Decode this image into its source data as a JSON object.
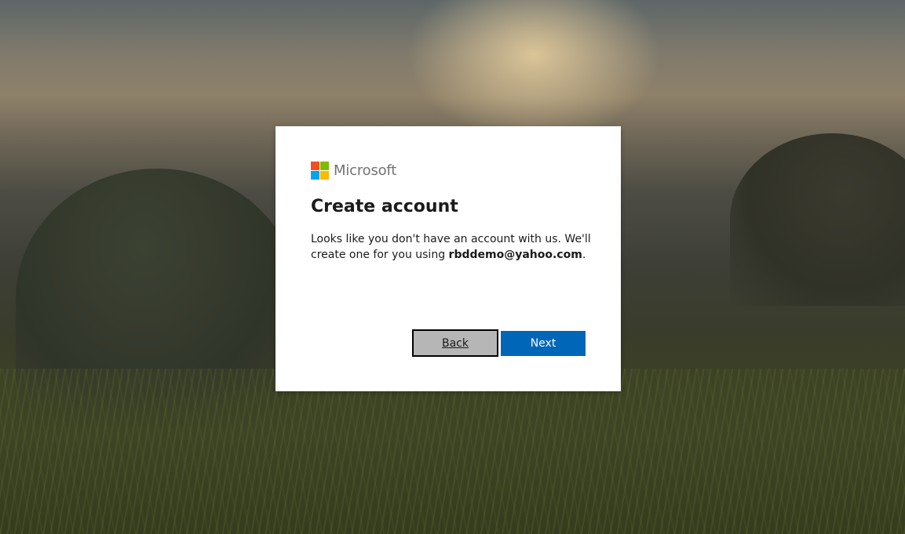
{
  "brand": {
    "name": "Microsoft",
    "logo_colors": [
      "#f25022",
      "#7fba00",
      "#00a4ef",
      "#ffb900"
    ]
  },
  "dialog": {
    "title": "Create account",
    "description_prefix": "Looks like you don't have an account with us. We'll create one for you using ",
    "email": "rbddemo@yahoo.com",
    "description_suffix": "."
  },
  "buttons": {
    "back_label": "Back",
    "next_label": "Next"
  },
  "colors": {
    "primary": "#0067b8",
    "secondary": "#b6b6b6"
  }
}
